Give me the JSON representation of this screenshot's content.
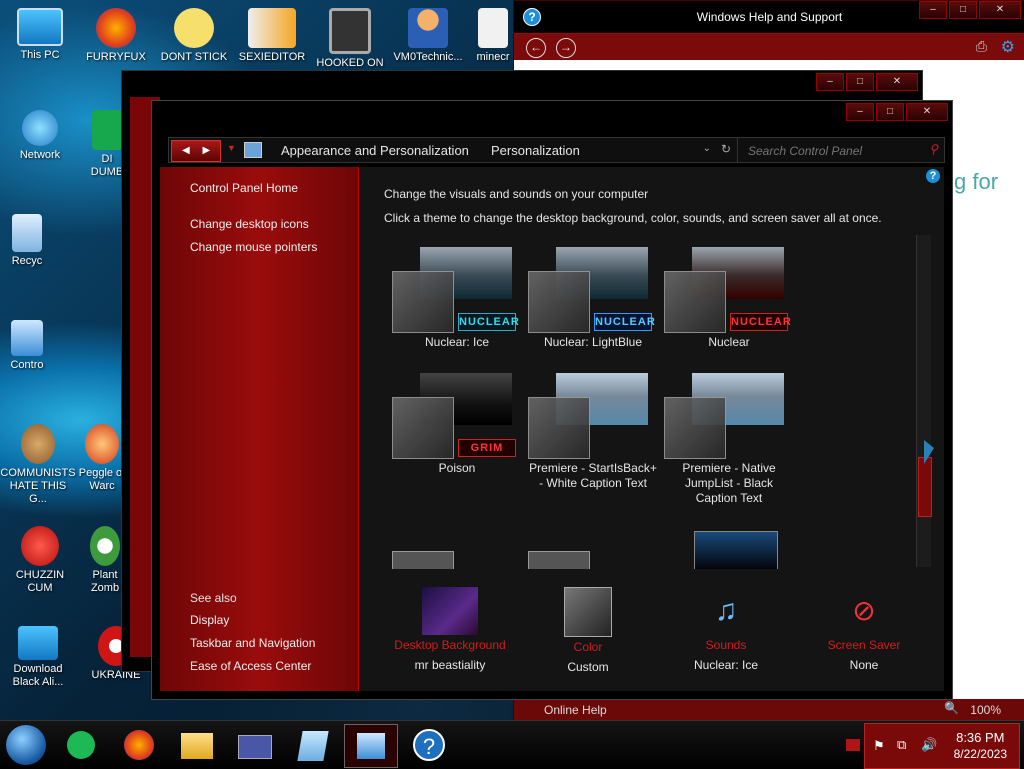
{
  "desktop": {
    "icons": [
      {
        "label": "This PC"
      },
      {
        "label": "FURRYFUX"
      },
      {
        "label": "DONT STICK"
      },
      {
        "label": "SEXIEDITOR"
      },
      {
        "label": "HOOKED ON"
      },
      {
        "label": "VM0Technic..."
      },
      {
        "label": "minecr"
      },
      {
        "label": "Network"
      },
      {
        "label": "DI"
      },
      {
        "label": "DUMB"
      },
      {
        "label": "Recyc"
      },
      {
        "label": "Contro"
      },
      {
        "label": "COMMUNISTS HATE THIS G..."
      },
      {
        "label": "Peggle of Warc"
      },
      {
        "label": "CHUZZIN CUM"
      },
      {
        "label": "Plant Zomb"
      },
      {
        "label": "Download Black Ali..."
      },
      {
        "label": "UKRAINE"
      }
    ]
  },
  "help_window": {
    "title": "Windows Help and Support",
    "body_text": "g for",
    "status_left": "Online Help",
    "zoom": "100%"
  },
  "control_panel": {
    "address": {
      "crumb1": "Appearance and Personalization",
      "crumb2": "Personalization"
    },
    "search": {
      "placeholder": "Search Control Panel"
    },
    "sidebar": {
      "links": [
        "Control Panel Home",
        "Change desktop icons",
        "Change mouse pointers"
      ],
      "see_also_title": "See also",
      "see_also": [
        "Display",
        "Taskbar and Navigation",
        "Ease of Access Center"
      ]
    },
    "content": {
      "heading": "Change the visuals and sounds on your computer",
      "subheading": "Click a theme to change the desktop background, color, sounds, and screen saver all at once.",
      "themes": [
        {
          "name": "Nuclear: Ice",
          "badge": "NUCLEAR"
        },
        {
          "name": "Nuclear: LightBlue",
          "badge": "NUCLEAR"
        },
        {
          "name": "Nuclear",
          "badge": "NUCLEAR"
        },
        {
          "name": "Poison",
          "badge": "GRIM"
        },
        {
          "name": "Premiere - StartIsBack+ - White Caption Text",
          "badge": ""
        },
        {
          "name": "Premiere - Native JumpList - Black Caption Text",
          "badge": ""
        }
      ],
      "bottom": [
        {
          "label": "Desktop Background",
          "value": "mr beastiality"
        },
        {
          "label": "Color",
          "value": "Custom"
        },
        {
          "label": "Sounds",
          "value": "Nuclear: Ice"
        },
        {
          "label": "Screen Saver",
          "value": "None"
        }
      ]
    }
  },
  "taskbar": {
    "time": "8:36 PM",
    "date": "8/22/2023"
  }
}
